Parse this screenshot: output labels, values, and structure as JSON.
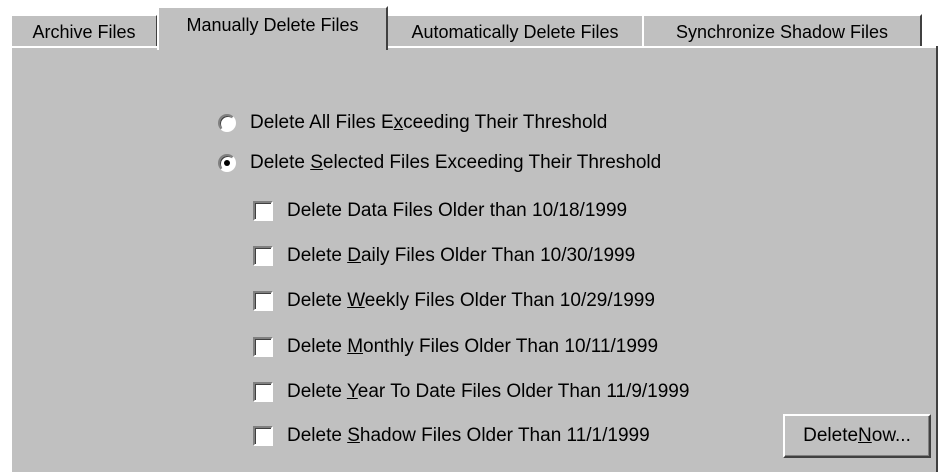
{
  "tabs": [
    {
      "label": "Archive Files",
      "active": false
    },
    {
      "label": "Manually Delete Files",
      "active": true
    },
    {
      "label": "Automatically Delete Files",
      "active": false
    },
    {
      "label": "Synchronize Shadow Files",
      "active": false
    }
  ],
  "delete_mode": {
    "all": {
      "label_pre": "Delete All Files E",
      "label_key": "x",
      "label_post": "ceeding Their Threshold",
      "selected": false
    },
    "selected": {
      "label_pre": "Delete ",
      "label_key": "S",
      "label_post": "elected Files Exceeding Their Threshold",
      "selected": true
    }
  },
  "checkboxes": [
    {
      "label_pre": "Delete Data Files Older than 10/18/1999",
      "label_key": "",
      "label_post": "",
      "checked": false
    },
    {
      "label_pre": "Delete ",
      "label_key": "D",
      "label_post": "aily Files Older Than 10/30/1999",
      "checked": false
    },
    {
      "label_pre": "Delete ",
      "label_key": "W",
      "label_post": "eekly Files Older Than 10/29/1999",
      "checked": false
    },
    {
      "label_pre": "Delete ",
      "label_key": "M",
      "label_post": "onthly Files Older Than 10/11/1999",
      "checked": false
    },
    {
      "label_pre": "Delete ",
      "label_key": "Y",
      "label_post": "ear To Date Files Older Than 11/9/1999",
      "checked": false
    },
    {
      "label_pre": "Delete ",
      "label_key": "S",
      "label_post": "hadow Files Older Than 11/1/1999",
      "checked": false
    }
  ],
  "delete_now_button": {
    "label_pre": "Delete ",
    "label_key": "N",
    "label_post": "ow..."
  },
  "colors": {
    "face": "#c0c0c0",
    "highlight": "#ffffff",
    "shadow": "#808080",
    "dark_shadow": "#404040"
  }
}
